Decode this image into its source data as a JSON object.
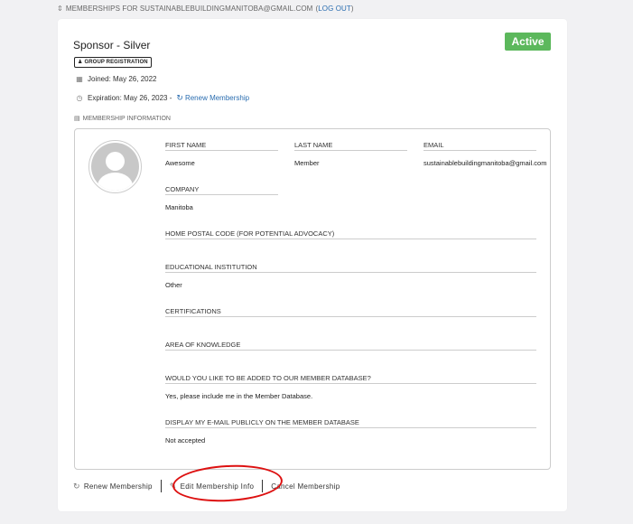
{
  "topbar": {
    "icon": "toggle-icon",
    "prefix": "MEMBERSHIPS FOR SUSTAINABLEBUILDINGMANITOBA@GMAIL.COM",
    "open_paren": "(",
    "logout_label": "LOG OUT",
    "close_paren": ")"
  },
  "membership": {
    "title": "Sponsor - Silver",
    "status": "Active",
    "status_color": "#5cb85c",
    "group_badge": "GROUP REGISTRATION",
    "joined": "Joined: May 26, 2022",
    "expiration": "Expiration: May 26, 2023 -",
    "renew_link": "Renew Membership"
  },
  "info_section": {
    "label": "MEMBERSHIP INFORMATION"
  },
  "fields": {
    "first_name": {
      "label": "FIRST NAME",
      "value": "Awesome"
    },
    "last_name": {
      "label": "LAST NAME",
      "value": "Member"
    },
    "email": {
      "label": "EMAIL",
      "value": "sustainablebuildingmanitoba@gmail.com"
    },
    "company": {
      "label": "COMPANY",
      "value": "Manitoba"
    },
    "postal_code": {
      "label": "HOME POSTAL CODE (FOR POTENTIAL ADVOCACY)",
      "value": ""
    },
    "institution": {
      "label": "EDUCATIONAL INSTITUTION",
      "value": "Other"
    },
    "certifications": {
      "label": "CERTIFICATIONS",
      "value": ""
    },
    "knowledge": {
      "label": "AREA OF KNOWLEDGE",
      "value": ""
    },
    "database": {
      "label": "WOULD YOU LIKE TO BE ADDED TO OUR MEMBER DATABASE?",
      "value": "Yes, please include me in the Member Database."
    },
    "display_email": {
      "label": "DISPLAY MY E-MAIL PUBLICLY ON THE MEMBER DATABASE",
      "value": "Not accepted"
    }
  },
  "actions": {
    "renew": "Renew Membership",
    "edit": "Edit Membership Info",
    "cancel": "Cancel Membership"
  },
  "colors": {
    "link": "#2a6db0",
    "highlight": "#dd1111"
  }
}
